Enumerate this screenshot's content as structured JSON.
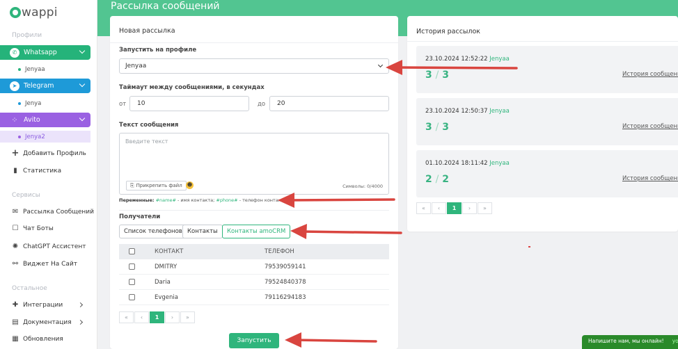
{
  "sidebar": {
    "logo": "wappi",
    "sections": {
      "profiles": "Профили",
      "services": "Сервисы",
      "other": "Остальное"
    },
    "platforms": [
      {
        "label": "Whatsapp",
        "icon": "whatsapp-icon",
        "color": "#25b37a",
        "sub": "Jenyaa"
      },
      {
        "label": "Telegram",
        "icon": "telegram-icon",
        "color": "#1e9ad8",
        "sub": "Jenya"
      },
      {
        "label": "Avito",
        "icon": "avito-icon",
        "color": "#9a61e2",
        "sub": "Jenya2"
      }
    ],
    "add_profile": "Добавить Профиль",
    "stats": "Статистика",
    "services": [
      "Рассылка Сообщений",
      "Чат Боты",
      "ChatGPT Ассистент",
      "Виджет На Сайт"
    ],
    "other": [
      "Интеграции",
      "Документация",
      "Обновления"
    ]
  },
  "header": {
    "title": "Рассылка сообщений"
  },
  "form": {
    "title": "Новая рассылка",
    "profile_label": "Запустить на профиле",
    "profile_value": "Jenyaa",
    "timeout_label": "Таймаут между сообщениями, в секундах",
    "from_label": "от",
    "from_value": "10",
    "to_label": "до",
    "to_value": "20",
    "text_label": "Текст сообщения",
    "text_placeholder": "Введите текст",
    "attach": "Прикрепить файл",
    "counter": "Символы: 0/4000",
    "vars_label": "Переменные:",
    "var_name": "#name#",
    "var_name_desc": "- имя контакта;",
    "var_phone": "#phone#",
    "var_phone_desc": "- телефон контакта",
    "recipients_label": "Получатели",
    "tabs": [
      "Список телефонов",
      "Контакты",
      "Контакты amoCRM"
    ],
    "table_headers": [
      "КОНТАКТ",
      "ТЕЛЕФОН"
    ],
    "rows": [
      {
        "name": "DMITRY",
        "phone": "79539059141"
      },
      {
        "name": "Daria",
        "phone": "79524840378"
      },
      {
        "name": "Evgenia",
        "phone": "79116294183"
      }
    ],
    "page": "1",
    "run": "Запустить"
  },
  "history": {
    "title": "История рассылок",
    "items": [
      {
        "date": "23.10.2024 12:52:22",
        "profile": "Jenyaa",
        "sent": "3",
        "total": "3"
      },
      {
        "date": "23.10.2024 12:50:37",
        "profile": "Jenyaa",
        "sent": "3",
        "total": "3"
      },
      {
        "date": "01.10.2024 18:11:42",
        "profile": "Jenyaa",
        "sent": "2",
        "total": "2"
      }
    ],
    "link": "История сообщений",
    "page": "1"
  },
  "pager_glyphs": {
    "first": "«",
    "prev": "‹",
    "next": "›",
    "last": "»"
  },
  "chat_widget": {
    "text": "Напишите нам, мы онлайн!",
    "tail": "yo"
  }
}
